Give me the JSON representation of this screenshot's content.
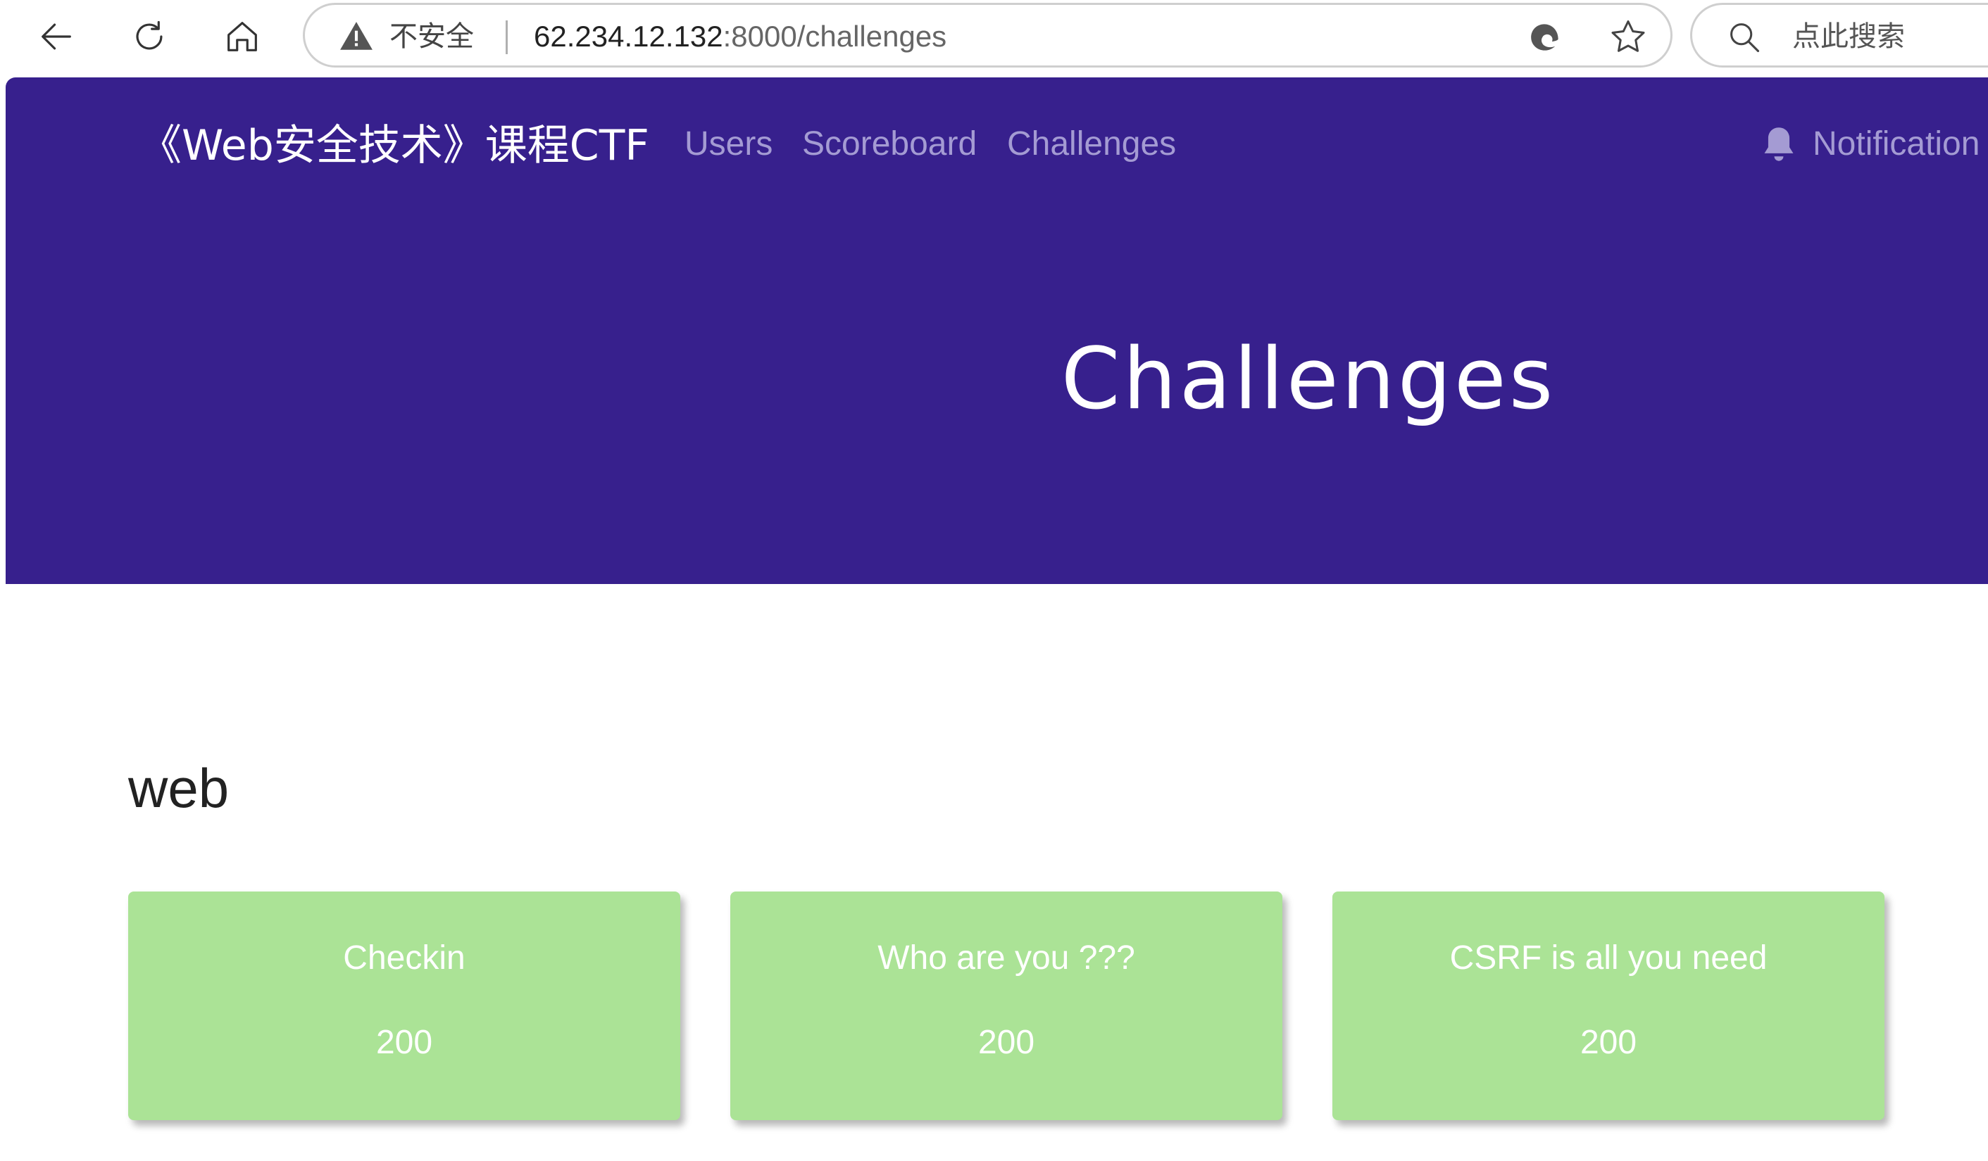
{
  "browser": {
    "security_label": "不安全",
    "url_host": "62.234.12.132",
    "url_rest": ":8000/challenges",
    "search_placeholder": "点此搜索"
  },
  "navbar": {
    "brand": "《Web安全技术》课程CTF",
    "links": [
      "Users",
      "Scoreboard",
      "Challenges"
    ],
    "notifications_label": "Notification"
  },
  "hero": {
    "title": "Challenges"
  },
  "category": {
    "name": "web",
    "challenges": [
      {
        "name": "Checkin",
        "value": "200"
      },
      {
        "name": "Who are you ???",
        "value": "200"
      },
      {
        "name": "CSRF is all you need",
        "value": "200"
      }
    ]
  },
  "colors": {
    "header_bg": "#37208d",
    "nav_link": "#a49bd3",
    "card_bg": "#abe396"
  },
  "icons": [
    "back-arrow-icon",
    "refresh-icon",
    "home-icon",
    "warning-icon",
    "edge-icon",
    "star-icon",
    "search-icon",
    "bell-icon"
  ]
}
